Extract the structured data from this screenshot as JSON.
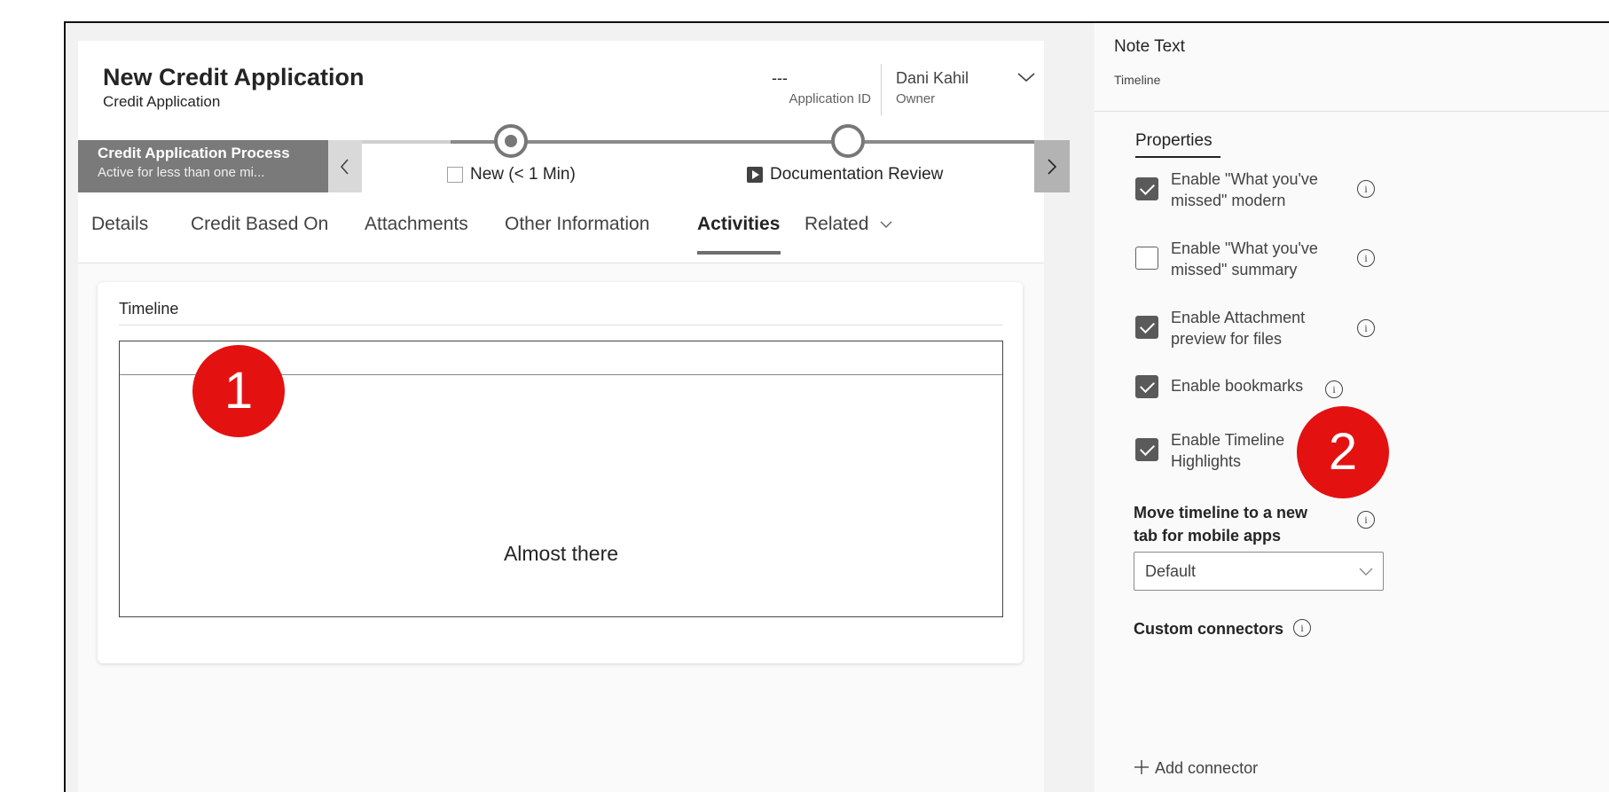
{
  "form": {
    "title": "New Credit Application",
    "subtitle": "Credit Application",
    "application_id_value": "---",
    "application_id_label": "Application ID",
    "owner_value": "Dani Kahil",
    "owner_label": "Owner"
  },
  "bpf": {
    "process_name": "Credit Application Process",
    "process_status": "Active for less than one mi...",
    "stages": [
      {
        "label": "New (< 1 Min)",
        "active": true
      },
      {
        "label": "Documentation Review",
        "active": false
      }
    ]
  },
  "tabs": [
    {
      "label": "Details",
      "active": false
    },
    {
      "label": "Credit Based On",
      "active": false
    },
    {
      "label": "Attachments",
      "active": false
    },
    {
      "label": "Other Information",
      "active": false
    },
    {
      "label": "Activities",
      "active": true
    },
    {
      "label": "Related",
      "active": false
    }
  ],
  "timeline": {
    "title": "Timeline",
    "message": "Almost there"
  },
  "badges": [
    "1",
    "2"
  ],
  "panel": {
    "title": "Note Text",
    "subtitle": "Timeline",
    "properties_tab": "Properties",
    "options": [
      {
        "label_line1": "Enable \"What you've",
        "label_line2": "missed\" modern",
        "checked": true
      },
      {
        "label_line1": "Enable \"What you've",
        "label_line2": "missed\" summary",
        "checked": false
      },
      {
        "label_line1": "Enable Attachment",
        "label_line2": "preview for files",
        "checked": true
      },
      {
        "label_line1": "Enable bookmarks",
        "label_line2": "",
        "checked": true
      },
      {
        "label_line1": "Enable Timeline",
        "label_line2": "Highlights",
        "checked": true
      }
    ],
    "move_label_line1": "Move timeline to a new",
    "move_label_line2": "tab for mobile apps",
    "move_select_value": "Default",
    "custom_connectors_label": "Custom connectors",
    "add_connector_label": "Add connector"
  },
  "icons": {
    "info": "info-icon",
    "chevron_down": "chevron-down-icon",
    "chevron_left": "chevron-left-icon",
    "chevron_right": "chevron-right-icon",
    "add": "plus-icon"
  }
}
